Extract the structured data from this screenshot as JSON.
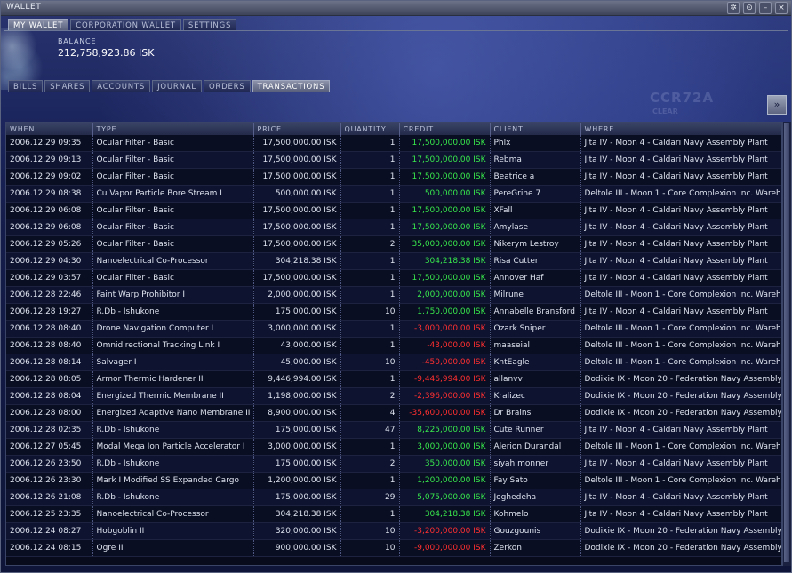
{
  "window": {
    "title": "WALLET"
  },
  "titlebar_icons": [
    "pin-icon",
    "settings-icon",
    "minimize-icon",
    "close-icon"
  ],
  "top_tabs": [
    "MY WALLET",
    "CORPORATION WALLET",
    "SETTINGS"
  ],
  "balance": {
    "label": "BALANCE",
    "value": "212,758,923.86 ISK"
  },
  "sub_tabs": [
    "BILLS",
    "SHARES",
    "ACCOUNTS",
    "JOURNAL",
    "ORDERS",
    "TRANSACTIONS"
  ],
  "watermark": {
    "text": "CCR72A",
    "sub": "CLEAR"
  },
  "colors": {
    "positive": "#38e84c",
    "negative": "#ff3030",
    "accent": "#1d2760"
  },
  "table": {
    "columns": [
      "WHEN",
      "TYPE",
      "PRICE",
      "QUANTITY",
      "CREDIT",
      "CLIENT",
      "WHERE"
    ],
    "rows": [
      [
        "2006.12.29 09:35",
        "Ocular Filter - Basic",
        "17,500,000.00 ISK",
        "1",
        "17,500,000.00 ISK",
        "Phlx",
        "Jita IV - Moon 4 - Caldari Navy Assembly Plant"
      ],
      [
        "2006.12.29 09:13",
        "Ocular Filter - Basic",
        "17,500,000.00 ISK",
        "1",
        "17,500,000.00 ISK",
        "Rebma",
        "Jita IV - Moon 4 - Caldari Navy Assembly Plant"
      ],
      [
        "2006.12.29 09:02",
        "Ocular Filter - Basic",
        "17,500,000.00 ISK",
        "1",
        "17,500,000.00 ISK",
        "Beatrice a",
        "Jita IV - Moon 4 - Caldari Navy Assembly Plant"
      ],
      [
        "2006.12.29 08:38",
        "Cu Vapor Particle Bore Stream I",
        "500,000.00 ISK",
        "1",
        "500,000.00 ISK",
        "PereGrine 7",
        "Deltole III - Moon 1 - Core Complexion Inc. Wareh"
      ],
      [
        "2006.12.29 06:08",
        "Ocular Filter - Basic",
        "17,500,000.00 ISK",
        "1",
        "17,500,000.00 ISK",
        "XFall",
        "Jita IV - Moon 4 - Caldari Navy Assembly Plant"
      ],
      [
        "2006.12.29 06:08",
        "Ocular Filter - Basic",
        "17,500,000.00 ISK",
        "1",
        "17,500,000.00 ISK",
        "Amylase",
        "Jita IV - Moon 4 - Caldari Navy Assembly Plant"
      ],
      [
        "2006.12.29 05:26",
        "Ocular Filter - Basic",
        "17,500,000.00 ISK",
        "2",
        "35,000,000.00 ISK",
        "Nikerym Lestroy",
        "Jita IV - Moon 4 - Caldari Navy Assembly Plant"
      ],
      [
        "2006.12.29 04:30",
        "Nanoelectrical Co-Processor",
        "304,218.38 ISK",
        "1",
        "304,218.38 ISK",
        "Risa Cutter",
        "Jita IV - Moon 4 - Caldari Navy Assembly Plant"
      ],
      [
        "2006.12.29 03:57",
        "Ocular Filter - Basic",
        "17,500,000.00 ISK",
        "1",
        "17,500,000.00 ISK",
        "Annover Haf",
        "Jita IV - Moon 4 - Caldari Navy Assembly Plant"
      ],
      [
        "2006.12.28 22:46",
        "Faint Warp Prohibitor I",
        "2,000,000.00 ISK",
        "1",
        "2,000,000.00 ISK",
        "Milrune",
        "Deltole III - Moon 1 - Core Complexion Inc. Wareh"
      ],
      [
        "2006.12.28 19:27",
        "R.Db - Ishukone",
        "175,000.00 ISK",
        "10",
        "1,750,000.00 ISK",
        "Annabelle Bransford",
        "Jita IV - Moon 4 - Caldari Navy Assembly Plant"
      ],
      [
        "2006.12.28 08:40",
        "Drone Navigation Computer I",
        "3,000,000.00 ISK",
        "1",
        "-3,000,000.00 ISK",
        "Ozark Sniper",
        "Deltole III - Moon 1 - Core Complexion Inc. Wareh"
      ],
      [
        "2006.12.28 08:40",
        "Omnidirectional Tracking Link I",
        "43,000.00 ISK",
        "1",
        "-43,000.00 ISK",
        "maaseial",
        "Deltole III - Moon 1 - Core Complexion Inc. Wareh"
      ],
      [
        "2006.12.28 08:14",
        "Salvager I",
        "45,000.00 ISK",
        "10",
        "-450,000.00 ISK",
        "KntEagle",
        "Deltole III - Moon 1 - Core Complexion Inc. Wareh"
      ],
      [
        "2006.12.28 08:05",
        "Armor Thermic Hardener II",
        "9,446,994.00 ISK",
        "1",
        "-9,446,994.00 ISK",
        "allanvv",
        "Dodixie IX - Moon 20 - Federation Navy Assembly"
      ],
      [
        "2006.12.28 08:04",
        "Energized Thermic Membrane II",
        "1,198,000.00 ISK",
        "2",
        "-2,396,000.00 ISK",
        "Kralizec",
        "Dodixie IX - Moon 20 - Federation Navy Assembly"
      ],
      [
        "2006.12.28 08:00",
        "Energized Adaptive Nano Membrane II",
        "8,900,000.00 ISK",
        "4",
        "-35,600,000.00 ISK",
        "Dr Brains",
        "Dodixie IX - Moon 20 - Federation Navy Assembly"
      ],
      [
        "2006.12.28 02:35",
        "R.Db - Ishukone",
        "175,000.00 ISK",
        "47",
        "8,225,000.00 ISK",
        "Cute Runner",
        "Jita IV - Moon 4 - Caldari Navy Assembly Plant"
      ],
      [
        "2006.12.27 05:45",
        "Modal Mega Ion Particle Accelerator I",
        "3,000,000.00 ISK",
        "1",
        "3,000,000.00 ISK",
        "Alerion Durandal",
        "Deltole III - Moon 1 - Core Complexion Inc. Wareh"
      ],
      [
        "2006.12.26 23:50",
        "R.Db - Ishukone",
        "175,000.00 ISK",
        "2",
        "350,000.00 ISK",
        "siyah monner",
        "Jita IV - Moon 4 - Caldari Navy Assembly Plant"
      ],
      [
        "2006.12.26 23:30",
        "Mark I Modified SS Expanded Cargo",
        "1,200,000.00 ISK",
        "1",
        "1,200,000.00 ISK",
        "Fay Sato",
        "Deltole III - Moon 1 - Core Complexion Inc. Wareh"
      ],
      [
        "2006.12.26 21:08",
        "R.Db - Ishukone",
        "175,000.00 ISK",
        "29",
        "5,075,000.00 ISK",
        "Joghedeha",
        "Jita IV - Moon 4 - Caldari Navy Assembly Plant"
      ],
      [
        "2006.12.25 23:35",
        "Nanoelectrical Co-Processor",
        "304,218.38 ISK",
        "1",
        "304,218.38 ISK",
        "Kohmelo",
        "Jita IV - Moon 4 - Caldari Navy Assembly Plant"
      ],
      [
        "2006.12.24 08:27",
        "Hobgoblin II",
        "320,000.00 ISK",
        "10",
        "-3,200,000.00 ISK",
        "Gouzgounis",
        "Dodixie IX - Moon 20 - Federation Navy Assembly"
      ],
      [
        "2006.12.24 08:15",
        "Ogre II",
        "900,000.00 ISK",
        "10",
        "-9,000,000.00 ISK",
        "Zerkon",
        "Dodixie IX - Moon 20 - Federation Navy Assembly"
      ]
    ]
  }
}
